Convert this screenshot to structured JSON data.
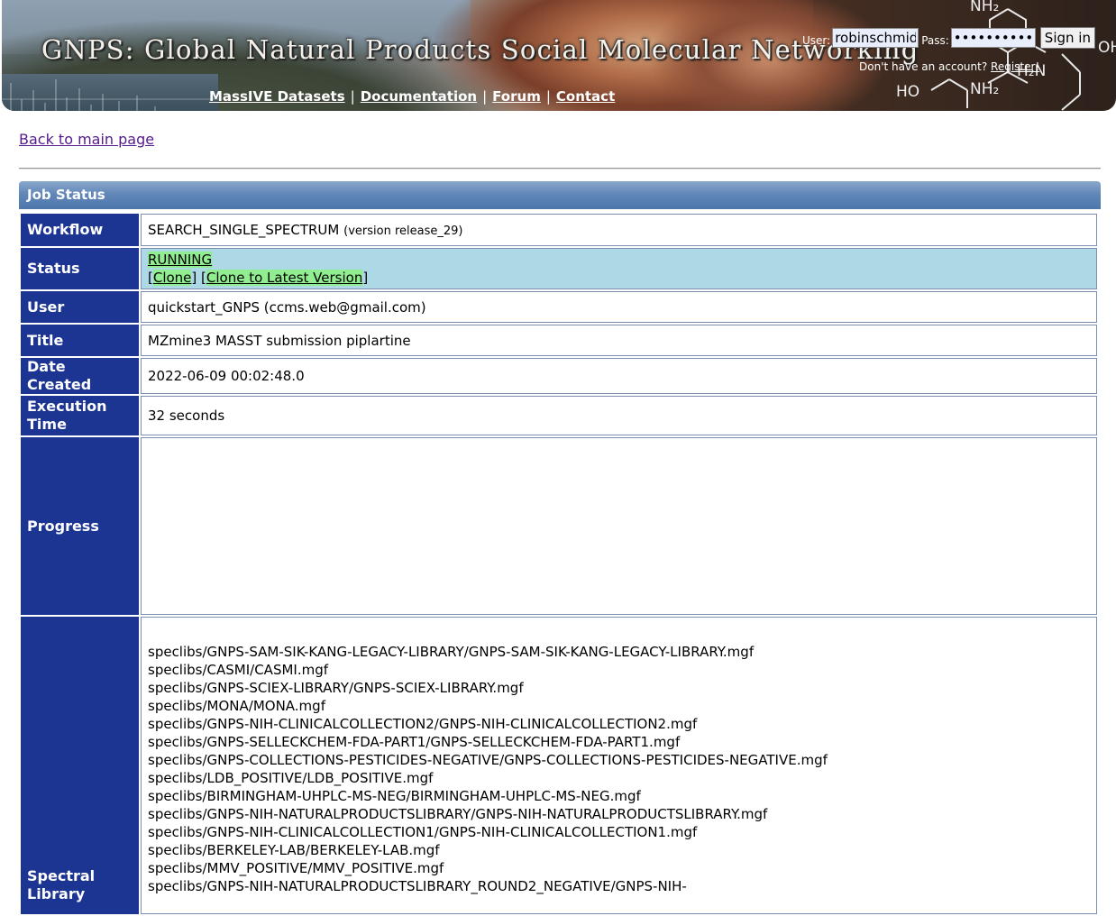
{
  "banner": {
    "title": "GNPS: Global Natural Products Social Molecular Networking",
    "nav": [
      "MassIVE Datasets",
      "Documentation",
      "Forum",
      "Contact"
    ],
    "login": {
      "user_label": "User:",
      "user_value": "robinschmid",
      "pass_label": "Pass:",
      "pass_value": "••••••••••",
      "sign_in_label": "Sign in",
      "register_prompt": "Don't have an account?",
      "register_link": "Register!"
    }
  },
  "back_link": "Back to main page",
  "section_title": "Job Status",
  "job": {
    "workflow_label": "Workflow",
    "workflow": "SEARCH_SINGLE_SPECTRUM",
    "workflow_version": "(version release_29)",
    "status_label": "Status",
    "status": "RUNNING",
    "clone": "Clone",
    "clone_latest": "Clone to Latest Version",
    "user_label": "User",
    "user": "quickstart_GNPS (ccms.web@gmail.com)",
    "title_label": "Title",
    "title": "MZmine3 MASST submission piplartine",
    "date_label": "Date Created",
    "date_created": "2022-06-09 00:02:48.0",
    "exec_label": "Execution Time",
    "execution_time": "32 seconds",
    "progress_label": "Progress",
    "library_label": "Spectral Library",
    "libraries": [
      "speclibs/GNPS-SAM-SIK-KANG-LEGACY-LIBRARY/GNPS-SAM-SIK-KANG-LEGACY-LIBRARY.mgf",
      "speclibs/CASMI/CASMI.mgf",
      "speclibs/GNPS-SCIEX-LIBRARY/GNPS-SCIEX-LIBRARY.mgf",
      "speclibs/MONA/MONA.mgf",
      "speclibs/GNPS-NIH-CLINICALCOLLECTION2/GNPS-NIH-CLINICALCOLLECTION2.mgf",
      "speclibs/GNPS-SELLECKCHEM-FDA-PART1/GNPS-SELLECKCHEM-FDA-PART1.mgf",
      "speclibs/GNPS-COLLECTIONS-PESTICIDES-NEGATIVE/GNPS-COLLECTIONS-PESTICIDES-NEGATIVE.mgf",
      "speclibs/LDB_POSITIVE/LDB_POSITIVE.mgf",
      "speclibs/BIRMINGHAM-UHPLC-MS-NEG/BIRMINGHAM-UHPLC-MS-NEG.mgf",
      "speclibs/GNPS-NIH-NATURALPRODUCTSLIBRARY/GNPS-NIH-NATURALPRODUCTSLIBRARY.mgf",
      "speclibs/GNPS-NIH-CLINICALCOLLECTION1/GNPS-NIH-CLINICALCOLLECTION1.mgf",
      "speclibs/BERKELEY-LAB/BERKELEY-LAB.mgf",
      "speclibs/MMV_POSITIVE/MMV_POSITIVE.mgf",
      "speclibs/GNPS-NIH-NATURALPRODUCTSLIBRARY_ROUND2_NEGATIVE/GNPS-NIH-"
    ]
  }
}
